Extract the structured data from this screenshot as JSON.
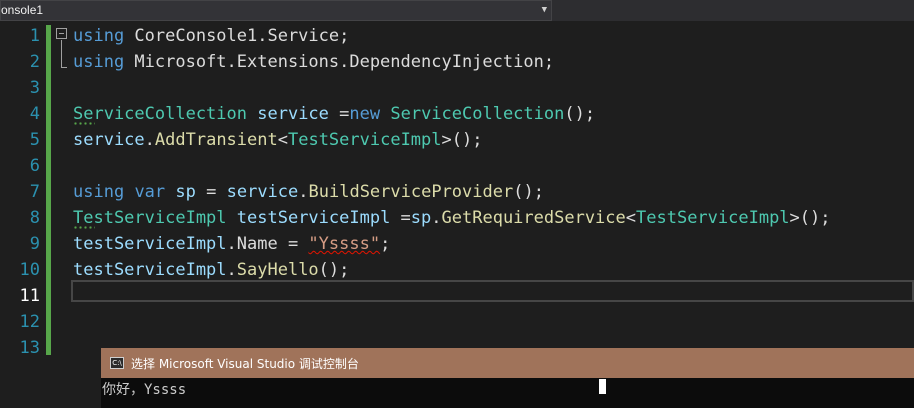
{
  "navbar": {
    "project_label": "onsole1"
  },
  "editor": {
    "line_numbers": [
      "1",
      "2",
      "3",
      "4",
      "5",
      "6",
      "7",
      "8",
      "9",
      "10",
      "11",
      "12",
      "13"
    ],
    "current_line": 11,
    "lines": [
      [
        {
          "t": "using",
          "c": "kw"
        },
        {
          "t": " CoreConsole1.Service;",
          "c": "pn"
        }
      ],
      [
        {
          "t": "using",
          "c": "kw"
        },
        {
          "t": " Microsoft.Extensions.DependencyInjection;",
          "c": "pn"
        }
      ],
      [],
      [
        {
          "t": "ServiceCollection",
          "c": "ty"
        },
        {
          "t": " ",
          "c": "pn"
        },
        {
          "t": "service",
          "c": "id"
        },
        {
          "t": " =",
          "c": "pn"
        },
        {
          "t": "new",
          "c": "kw"
        },
        {
          "t": " ",
          "c": "pn"
        },
        {
          "t": "ServiceCollection",
          "c": "ty"
        },
        {
          "t": "();",
          "c": "pn"
        }
      ],
      [
        {
          "t": "service",
          "c": "id"
        },
        {
          "t": ".",
          "c": "pn"
        },
        {
          "t": "AddTransient",
          "c": "mt"
        },
        {
          "t": "<",
          "c": "pn"
        },
        {
          "t": "TestServiceImpl",
          "c": "ty"
        },
        {
          "t": ">();",
          "c": "pn"
        }
      ],
      [],
      [
        {
          "t": "using",
          "c": "kw"
        },
        {
          "t": " ",
          "c": "pn"
        },
        {
          "t": "var",
          "c": "kw"
        },
        {
          "t": " ",
          "c": "pn"
        },
        {
          "t": "sp",
          "c": "id"
        },
        {
          "t": " = ",
          "c": "pn"
        },
        {
          "t": "service",
          "c": "id"
        },
        {
          "t": ".",
          "c": "pn"
        },
        {
          "t": "BuildServiceProvider",
          "c": "mt"
        },
        {
          "t": "();",
          "c": "pn"
        }
      ],
      [
        {
          "t": "TestServiceImpl",
          "c": "ty"
        },
        {
          "t": " ",
          "c": "pn"
        },
        {
          "t": "testServiceImpl",
          "c": "id"
        },
        {
          "t": " =",
          "c": "pn"
        },
        {
          "t": "sp",
          "c": "id"
        },
        {
          "t": ".",
          "c": "pn"
        },
        {
          "t": "GetRequiredService",
          "c": "mt"
        },
        {
          "t": "<",
          "c": "pn"
        },
        {
          "t": "TestServiceImpl",
          "c": "ty"
        },
        {
          "t": ">();",
          "c": "pn"
        }
      ],
      [
        {
          "t": "testServiceImpl",
          "c": "id"
        },
        {
          "t": ".Name = ",
          "c": "pn"
        },
        {
          "t": "\"Yssss\"",
          "c": "st"
        },
        {
          "t": ";",
          "c": "pn"
        }
      ],
      [
        {
          "t": "testServiceImpl",
          "c": "id"
        },
        {
          "t": ".",
          "c": "pn"
        },
        {
          "t": "SayHello",
          "c": "mt"
        },
        {
          "t": "();",
          "c": "pn"
        }
      ],
      [],
      [],
      []
    ]
  },
  "console": {
    "title": "选择 Microsoft Visual Studio 调试控制台",
    "icon": "console-app-icon",
    "icon_text": "C:\\",
    "output": "你好，Yssss"
  }
}
